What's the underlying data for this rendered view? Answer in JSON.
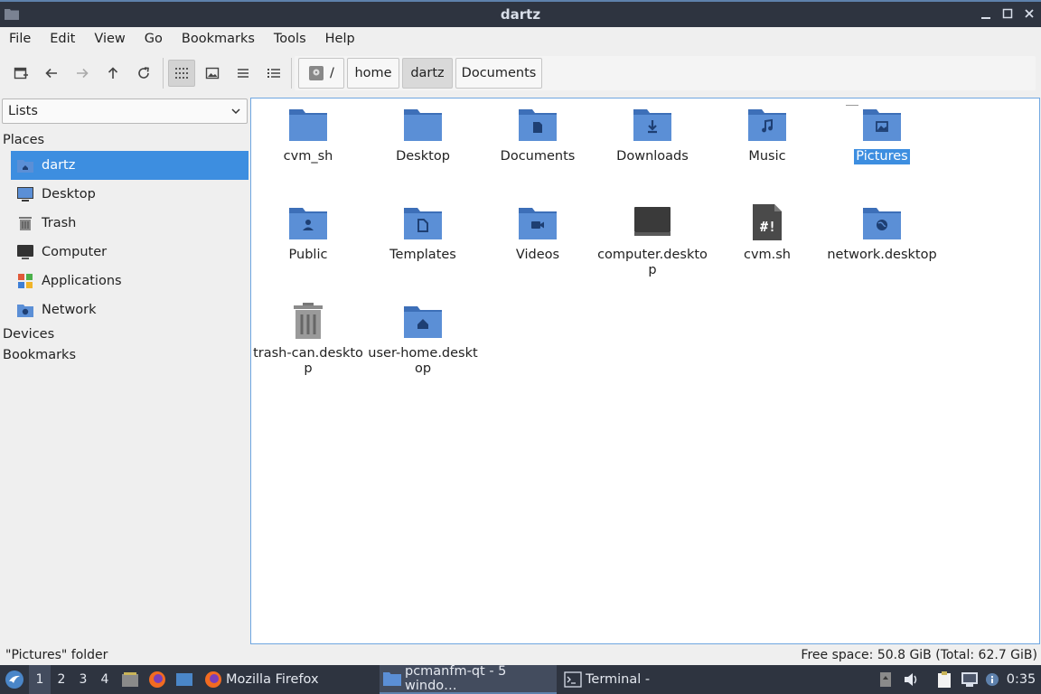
{
  "window": {
    "title": "dartz"
  },
  "menubar": {
    "items": [
      "File",
      "Edit",
      "View",
      "Go",
      "Bookmarks",
      "Tools",
      "Help"
    ]
  },
  "breadcrumb": {
    "root": "/",
    "items": [
      "home",
      "dartz",
      "Documents"
    ]
  },
  "sidebar": {
    "mode": "Lists",
    "places_header": "Places",
    "places": [
      "dartz",
      "Desktop",
      "Trash",
      "Computer",
      "Applications",
      "Network"
    ],
    "devices_header": "Devices",
    "bookmarks_header": "Bookmarks"
  },
  "files": [
    {
      "name": "cvm_sh",
      "icon": "folder-icon"
    },
    {
      "name": "Desktop",
      "icon": "folder-icon"
    },
    {
      "name": "Documents",
      "icon": "folder-documents-icon"
    },
    {
      "name": "Downloads",
      "icon": "folder-download-icon"
    },
    {
      "name": "Music",
      "icon": "folder-music-icon"
    },
    {
      "name": "Pictures",
      "icon": "folder-pictures-icon",
      "selected": true
    },
    {
      "name": "Public",
      "icon": "folder-public-icon"
    },
    {
      "name": "Templates",
      "icon": "folder-templates-icon"
    },
    {
      "name": "Videos",
      "icon": "folder-videos-icon"
    },
    {
      "name": "computer.desktop",
      "icon": "computer-icon"
    },
    {
      "name": "cvm.sh",
      "icon": "shell-script-icon"
    },
    {
      "name": "network.desktop",
      "icon": "folder-network-icon"
    },
    {
      "name": "trash-can.desktop",
      "icon": "trash-icon"
    },
    {
      "name": "user-home.desktop",
      "icon": "folder-home-icon"
    }
  ],
  "status": {
    "left": "\"Pictures\" folder",
    "right": "Free space: 50.8 GiB (Total: 62.7 GiB)"
  },
  "taskbar": {
    "workspaces": [
      "1",
      "2",
      "3",
      "4"
    ],
    "tasks": [
      "Mozilla Firefox",
      "pcmanfm-qt - 5 windo…",
      "Terminal -"
    ],
    "clock": "0:35"
  },
  "colors": {
    "folder": "#5b8fd6",
    "folder_dark": "#3d6fb8",
    "selection": "#3d8ee0",
    "titlebar": "#2e3440"
  }
}
